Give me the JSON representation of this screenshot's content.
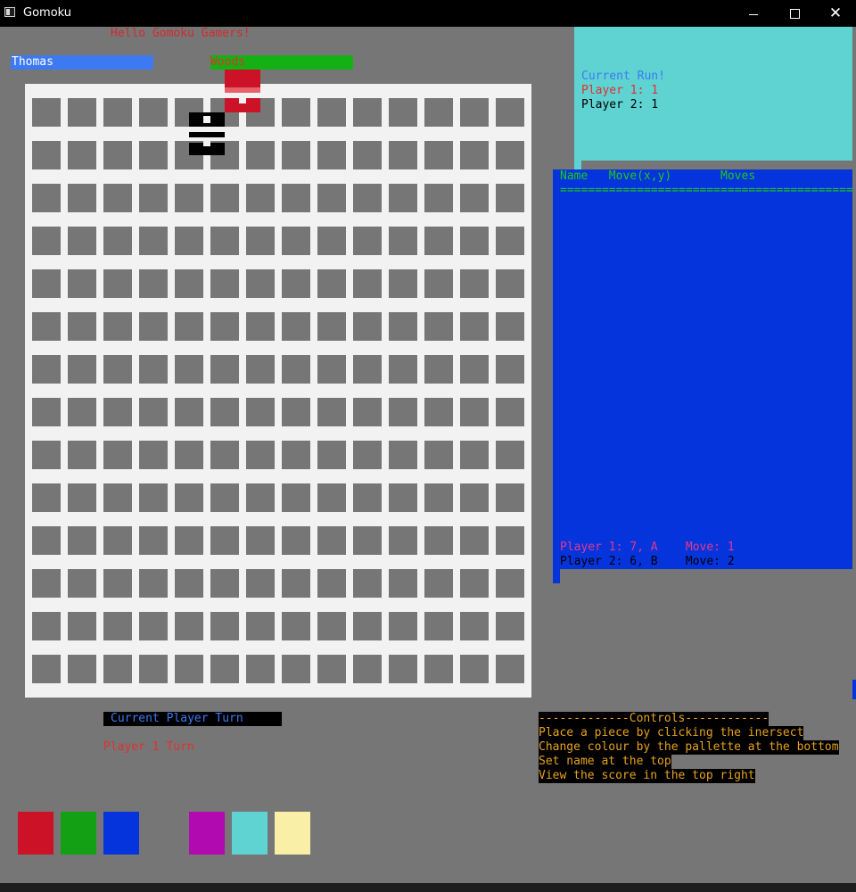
{
  "window": {
    "title": "Gomoku",
    "minimize_glyph": "",
    "maximize_glyph": "",
    "close_glyph": "✕"
  },
  "greeting": "Hello Gomoku Gamers!",
  "players": {
    "p1": {
      "name": "Thomas",
      "color": "#3d7af2"
    },
    "p2": {
      "name": "Woods",
      "color": "#14b014"
    }
  },
  "board": {
    "rows": 14,
    "cols": 14
  },
  "score": {
    "title": "Current Run!",
    "p1": "Player 1: 1",
    "p2": "Player 2: 1"
  },
  "move_log": {
    "header": "Name   Move(x,y)       Moves",
    "rule": "=============================================================",
    "rows": [
      {
        "text": "Player 1: 7, A    Move: 1"
      },
      {
        "text": "Player 2: 6, B    Move: 2"
      }
    ]
  },
  "turn": {
    "label": "Current Player Turn",
    "value": "Player 1 Turn"
  },
  "controls": [
    "-------------Controls------------",
    "Place a piece by clicking the inersect",
    "Change colour by the pallette at the bottom",
    "Set name at the top",
    "View the score in the top right"
  ],
  "palette": [
    {
      "name": "red",
      "color": "#cc1226"
    },
    {
      "name": "green",
      "color": "#14a014"
    },
    {
      "name": "blue",
      "color": "#0534dc"
    },
    {
      "name": "grey",
      "color": "#767676"
    },
    {
      "name": "magenta",
      "color": "#b00ab0"
    },
    {
      "name": "cyan",
      "color": "#5fd2d2"
    },
    {
      "name": "yellow",
      "color": "#f9efa6"
    }
  ],
  "icons": {
    "app": "app-icon",
    "minimize": "minimize-icon",
    "maximize": "maximize-icon",
    "close": "close-icon"
  }
}
